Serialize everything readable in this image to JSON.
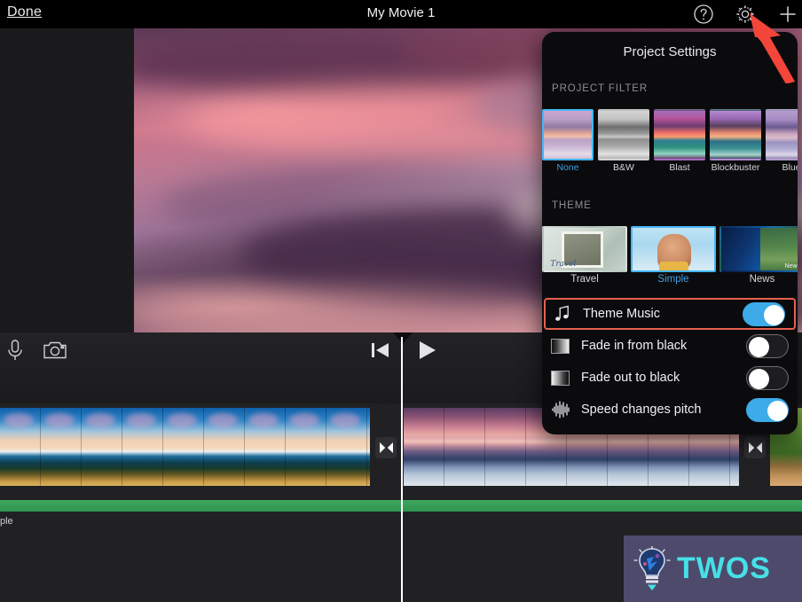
{
  "topbar": {
    "done_label": "Done",
    "title": "My Movie 1",
    "help_icon": "question-mark-circle-icon",
    "settings_icon": "gear-icon",
    "add_icon": "plus-icon"
  },
  "toolbar": {
    "mic_icon": "microphone-icon",
    "camera_icon": "camera-icon",
    "skip_to_start_icon": "skip-to-start-icon",
    "play_icon": "play-icon"
  },
  "timeline": {
    "audio_track_label": "ple",
    "transition_icon": "transition-bowtie-icon",
    "clips": [
      {
        "name": "clip-beach-sunrise",
        "frames": 10
      },
      {
        "name": "clip-purple-sunset",
        "frames": 10
      },
      {
        "name": "clip-forest-path",
        "frames": 1
      }
    ]
  },
  "panel": {
    "title": "Project Settings",
    "filter_section_label": "PROJECT FILTER",
    "theme_section_label": "THEME",
    "filters": [
      {
        "label": "None",
        "selected": true
      },
      {
        "label": "B&W",
        "selected": false
      },
      {
        "label": "Blast",
        "selected": false
      },
      {
        "label": "Blockbuster",
        "selected": false
      },
      {
        "label": "Blue",
        "selected": false
      }
    ],
    "themes": [
      {
        "label": "Travel",
        "selected": false
      },
      {
        "label": "Simple",
        "selected": true
      },
      {
        "label": "News",
        "selected": false
      }
    ],
    "settings": [
      {
        "label": "Theme Music",
        "icon": "music-note-icon",
        "on": true,
        "highlighted": true
      },
      {
        "label": "Fade in from black",
        "icon": "fade-in-gradient-icon",
        "on": false,
        "highlighted": false
      },
      {
        "label": "Fade out to black",
        "icon": "fade-out-gradient-icon",
        "on": false,
        "highlighted": false
      },
      {
        "label": "Speed changes pitch",
        "icon": "waveform-icon",
        "on": true,
        "highlighted": false
      }
    ]
  },
  "annotation": {
    "arrow_color": "#f3453a",
    "points_to": "gear-icon"
  },
  "watermark": {
    "text": "TWOS",
    "icon": "lightbulb-icon",
    "accent_color": "#46e0e8",
    "background_color": "#4e4a6b"
  },
  "colors": {
    "accent_blue": "#3cabe8",
    "selection_blue": "#45b6f2",
    "highlight_red": "#e8604f",
    "audio_green": "#3ea75f"
  }
}
